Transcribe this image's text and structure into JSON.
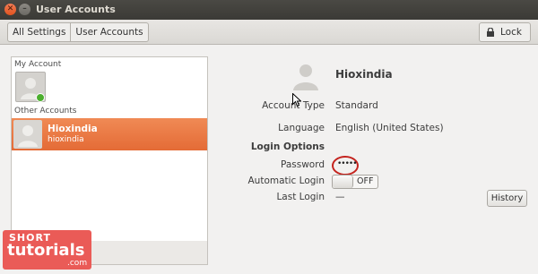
{
  "window": {
    "title": "User Accounts"
  },
  "toolbar": {
    "breadcrumbs": [
      "All Settings",
      "User Accounts"
    ],
    "lock_label": "Lock"
  },
  "sidebar": {
    "my_account_label": "My Account",
    "other_accounts_label": "Other Accounts",
    "users": [
      {
        "name": "Hioxindia",
        "login": "hioxindia",
        "selected": true
      }
    ]
  },
  "details": {
    "name": "Hioxindia",
    "fields": [
      {
        "label": "Account Type",
        "value": "Standard"
      },
      {
        "label": "Language",
        "value": "English (United States)"
      }
    ],
    "login_options_heading": "Login Options",
    "password_label": "Password",
    "password_value": "•••••",
    "auto_login_label": "Automatic Login",
    "auto_login_state": "OFF",
    "last_login_label": "Last Login",
    "last_login_value": "—",
    "history_button": "History"
  },
  "watermark": {
    "line1": "SHORT",
    "line2": "tutorials",
    "line3": ".com"
  },
  "colors": {
    "accent": "#e46b36",
    "highlight_circle": "#c4231e",
    "watermark": "#ea5b57",
    "online_status": "#4caf2f"
  }
}
